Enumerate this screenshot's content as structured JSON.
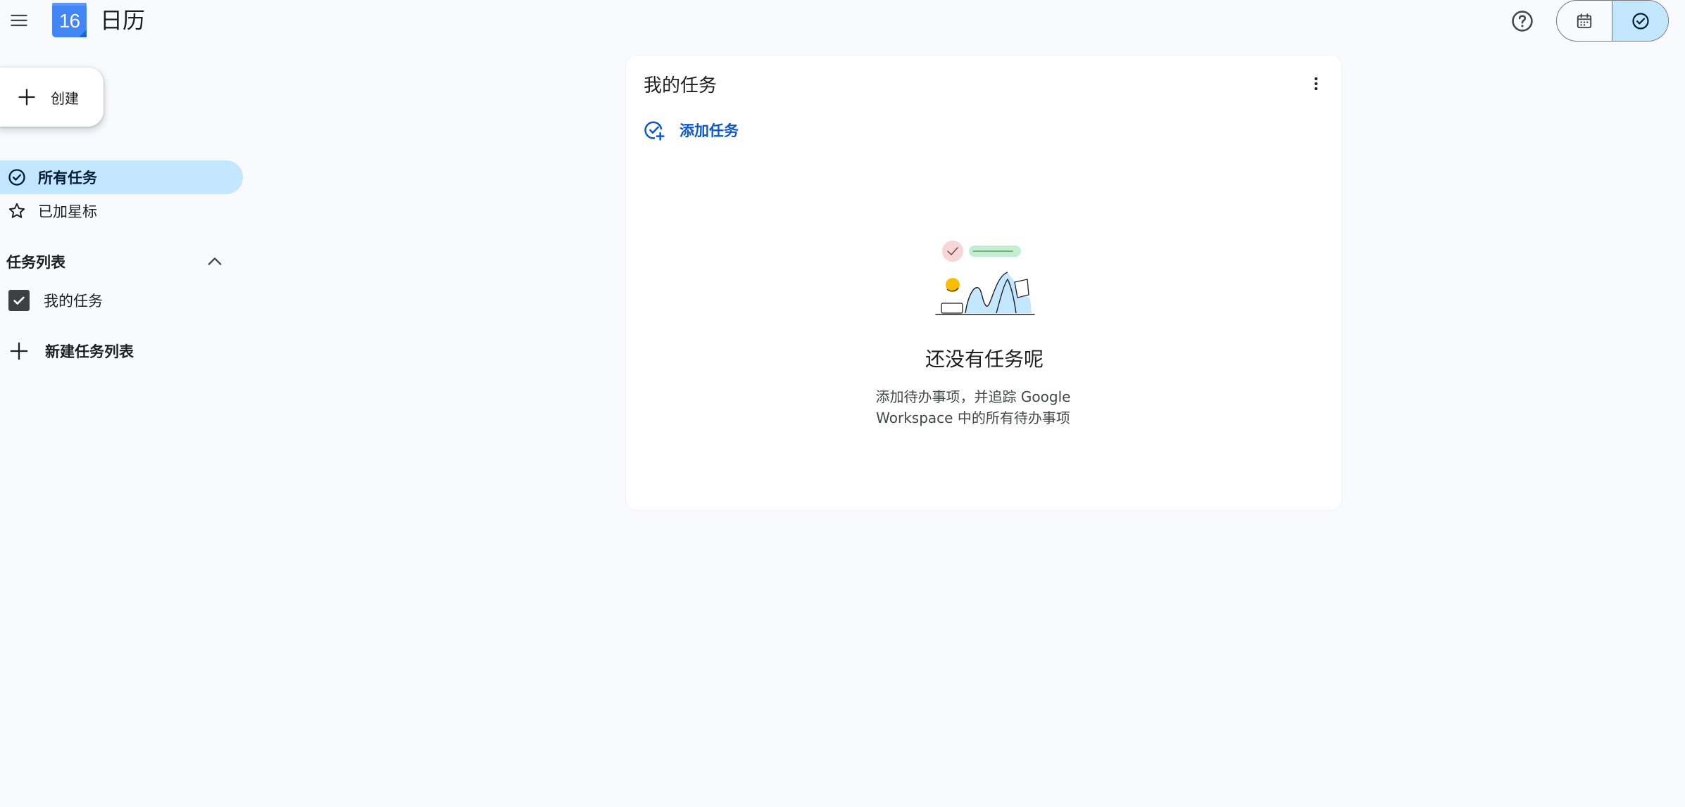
{
  "header": {
    "menu_icon": "hamburger-menu-icon",
    "logo_day": "16",
    "app_title": "日历",
    "help_icon": "help-circle-icon",
    "view_switch": {
      "calendar_icon": "calendar-icon",
      "tasks_icon": "task-check-icon",
      "active": "tasks"
    }
  },
  "sidebar": {
    "create_label": "创建",
    "nav": [
      {
        "label": "所有任务",
        "icon": "check-circle-icon",
        "active": true
      },
      {
        "label": "已加星标",
        "icon": "star-outline-icon",
        "active": false
      }
    ],
    "lists_section": {
      "title": "任务列表",
      "expanded": true,
      "lists": [
        {
          "label": "我的任务",
          "checked": true
        }
      ],
      "new_list_label": "新建任务列表"
    }
  },
  "main": {
    "list_title": "我的任务",
    "add_task_label": "添加任务",
    "empty_state": {
      "title": "还没有任务呢",
      "description": "添加待办事项，并追踪 Google Workspace 中的所有待办事项"
    }
  },
  "colors": {
    "background": "#f8fafd",
    "active_nav": "#c2e7ff",
    "accent_blue": "#0b57d0",
    "logo_blue": "#4285f4"
  }
}
